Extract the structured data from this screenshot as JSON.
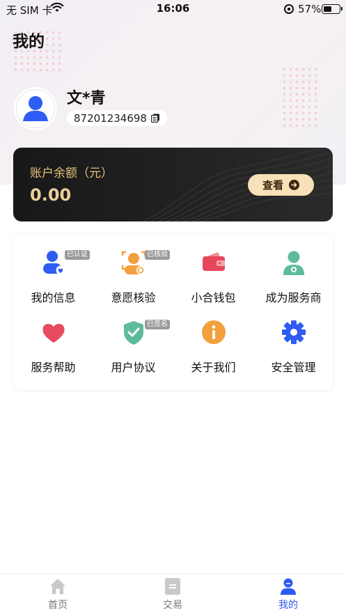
{
  "status_bar": {
    "carrier": "无 SIM 卡",
    "time": "16:06",
    "battery_percent": "57%",
    "battery_level": 0.57
  },
  "page": {
    "title": "我的"
  },
  "profile": {
    "name": "文*青",
    "id": "87201234698",
    "avatar_icon": "user-avatar-icon",
    "copy_icon": "copy-icon"
  },
  "balance": {
    "label": "账户余额（元）",
    "amount": "0.00",
    "view_button": "查看",
    "accent_color": "#ecd09a"
  },
  "menu": {
    "items": [
      {
        "label": "我的信息",
        "icon": "person-info-icon",
        "badge": "已认证"
      },
      {
        "label": "意愿核验",
        "icon": "face-verify-icon",
        "badge": "已核验"
      },
      {
        "label": "小合钱包",
        "icon": "wallet-icon",
        "badge": ""
      },
      {
        "label": "成为服务商",
        "icon": "service-provider-icon",
        "badge": ""
      },
      {
        "label": "服务帮助",
        "icon": "heart-icon",
        "badge": ""
      },
      {
        "label": "用户协议",
        "icon": "shield-check-icon",
        "badge": "已签名"
      },
      {
        "label": "关于我们",
        "icon": "info-icon",
        "badge": ""
      },
      {
        "label": "安全管理",
        "icon": "gear-icon",
        "badge": ""
      }
    ]
  },
  "tabbar": {
    "items": [
      {
        "label": "首页",
        "icon": "home-icon",
        "active": false
      },
      {
        "label": "交易",
        "icon": "transaction-icon",
        "active": false
      },
      {
        "label": "我的",
        "icon": "profile-icon",
        "active": true
      }
    ],
    "active_color": "#2d5bf0"
  }
}
